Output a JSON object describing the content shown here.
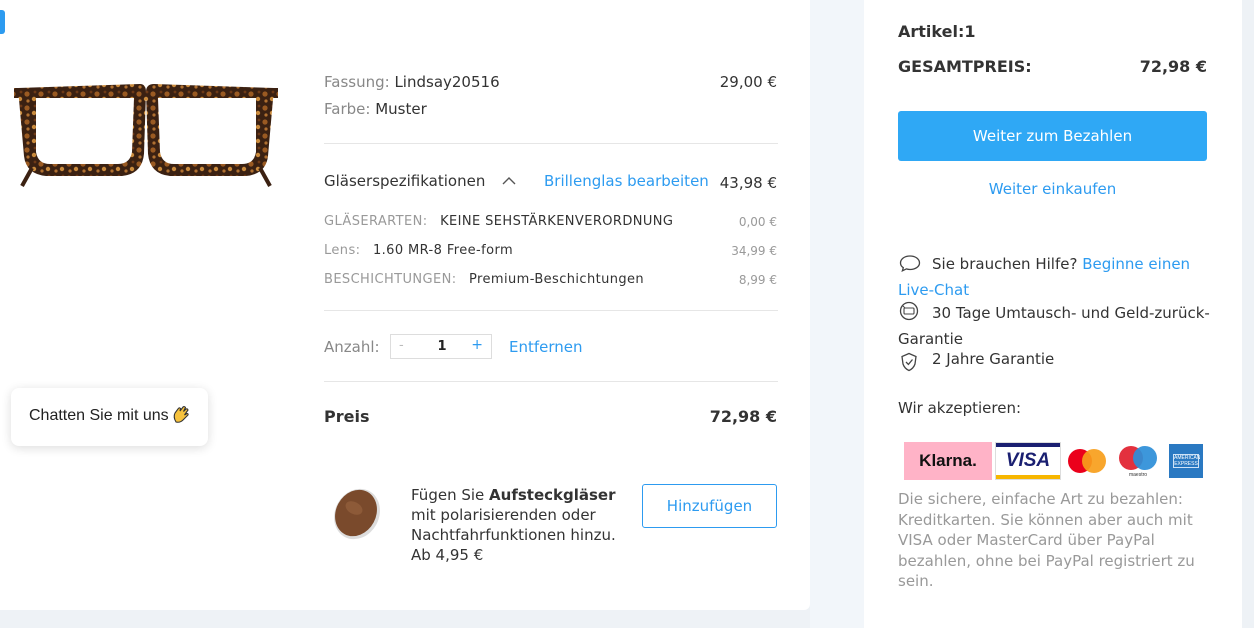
{
  "product": {
    "frame_label": "Fassung:",
    "frame_value": "Lindsay20516",
    "frame_price": "29,00 €",
    "color_label": "Farbe:",
    "color_value": "Muster"
  },
  "lenses": {
    "title": "Gläserspezifikationen",
    "edit_link": "Brillenglas bearbeiten",
    "price": "43,98 €",
    "rows": [
      {
        "label": "GLÄSERARTEN:",
        "value": "KEINE SEHSTÄRKENVERORDNUNG",
        "price": "0,00 €"
      },
      {
        "label": "Lens:",
        "value": "1.60 MR-8 Free-form",
        "price": "34,99 €"
      },
      {
        "label": "BESCHICHTUNGEN:",
        "value": "Premium-Beschichtungen",
        "price": "8,99 €"
      }
    ]
  },
  "quantity": {
    "label": "Anzahl:",
    "minus": "-",
    "value": "1",
    "plus": "+",
    "remove": "Entfernen"
  },
  "total": {
    "label": "Preis",
    "value": "72,98 €"
  },
  "clip_on": {
    "text_pre": "Fügen Sie ",
    "text_bold": "Aufsteckgläser",
    "text_post": " mit polarisierenden oder Nachtfahrfunktionen hinzu. Ab 4,95 €",
    "button": "Hinzufügen"
  },
  "chat_widget": {
    "label": "Chatten Sie mit uns",
    "icon": "waving-hand-icon"
  },
  "summary": {
    "items": "Artikel:1",
    "total_label": "GESAMTPREIS:",
    "total_value": "72,98 €",
    "checkout": "Weiter zum Bezahlen",
    "continue": "Weiter einkaufen",
    "help_text": "Sie brauchen Hilfe?",
    "help_link": "Beginne einen Live-Chat",
    "guarantee_30": "30 Tage Umtausch- und Geld-zurück-Garantie",
    "guarantee_2y": "2 Jahre Garantie",
    "accept_title": "Wir akzeptieren:",
    "payment_methods": [
      "Klarna.",
      "VISA",
      "mastercard",
      "maestro",
      "american-express"
    ],
    "payment_info": "Die sichere, einfache Art zu bezahlen: Kreditkarten. Sie können aber auch mit VISA oder MasterCard über PayPal bezahlen, ohne bei PayPal registriert zu sein."
  },
  "colors": {
    "accent": "#2d9bf0",
    "button": "#2fa8f5",
    "klarna_pink": "#ffb3c7"
  }
}
